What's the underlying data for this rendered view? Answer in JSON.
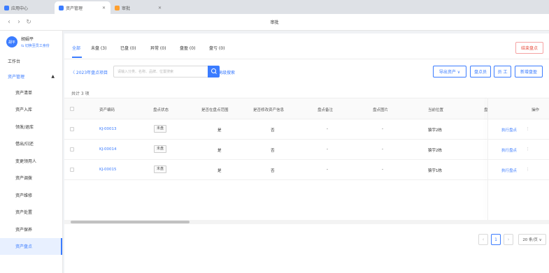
{
  "browser": {
    "tabs": [
      {
        "label": "应用中心",
        "icon": "app-icon",
        "color": "#3b7cff"
      },
      {
        "label": "资产管理",
        "icon": "asset-icon",
        "color": "#3b7cff"
      },
      {
        "label": "审批",
        "icon": "approval-icon",
        "color": "#ff9f2e"
      }
    ],
    "page_title": "审批"
  },
  "sidebar": {
    "user_name": "胡娟平",
    "user_avatar": "胡平",
    "user_role": "⇆ 切换至员工身份",
    "workbench": "工作台",
    "group": "资产管理",
    "items": [
      "资产清单",
      "资产入库",
      "领发/退库",
      "借出/归还",
      "变更领用人",
      "资产调拨",
      "资产维修",
      "资产处置",
      "资产保养",
      "资产盘点"
    ],
    "active_item": "资产盘点"
  },
  "status_tabs": [
    {
      "label": "全部"
    },
    {
      "label": "未盘 (3)"
    },
    {
      "label": "已盘 (0)"
    },
    {
      "label": "异常 (0)"
    },
    {
      "label": "盘盈 (0)"
    },
    {
      "label": "盘亏 (0)"
    }
  ],
  "finish_button": "结束盘点",
  "toolbar": {
    "back": "〈 2023年盘点项目",
    "search_placeholder": "请输入分类、名称、品牌、位置搜索",
    "advanced": "高级搜索",
    "export": "导出资产 ∨",
    "counter": "盘点员",
    "staff": "员 工",
    "add_profit": "新增盘盈"
  },
  "total": "共计 3 项",
  "table": {
    "headers": [
      "资产编码",
      "盘点状态",
      "是否在盘点范围",
      "是否修改资产信息",
      "盘点备注",
      "盘点图片",
      "当前位置",
      "盘",
      "操作"
    ],
    "rows": [
      {
        "code": "KJ-00013",
        "status": "未盘",
        "in_range": "是",
        "modified": "否",
        "note": "-",
        "image": "-",
        "location": "猿宇2栋",
        "action": "执行盘点",
        "more": "⋮"
      },
      {
        "code": "KJ-00014",
        "status": "未盘",
        "in_range": "是",
        "modified": "否",
        "note": "-",
        "image": "-",
        "location": "猿宇2栋",
        "action": "执行盘点",
        "more": "⋮"
      },
      {
        "code": "KJ-00015",
        "status": "未盘",
        "in_range": "是",
        "modified": "否",
        "note": "-",
        "image": "-",
        "location": "猿宇1栋",
        "action": "执行盘点",
        "more": "⋮"
      }
    ]
  },
  "pagination": {
    "prev": "‹",
    "current": "1",
    "next": "›",
    "page_size": "20 条/页 ∨"
  },
  "colors": {
    "accent": "#3b7cff",
    "danger": "#e74c3c"
  }
}
